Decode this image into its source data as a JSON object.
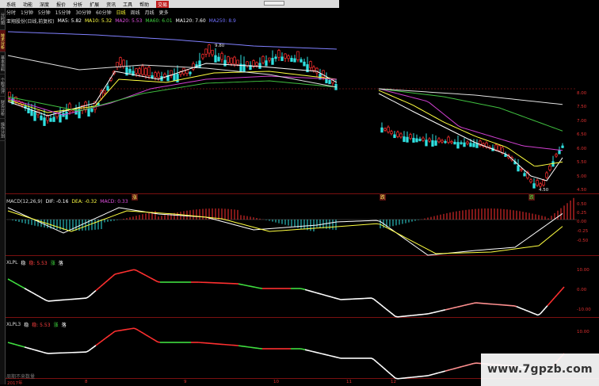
{
  "menu": [
    "系统",
    "功能",
    "深度",
    "报价",
    "分析",
    "扩展",
    "资讯",
    "工具",
    "帮助"
  ],
  "menu_active": "交易",
  "side_tabs": [
    "分时图",
    "技术分析",
    "基本资料",
    "个股点评",
    "财务分析",
    "操作计划"
  ],
  "periods": [
    "分时",
    "1分钟",
    "5分钟",
    "15分钟",
    "30分钟",
    "60分钟",
    "日线",
    "周线",
    "月线",
    "更多"
  ],
  "active_period": "日线",
  "main_legend": {
    "title": "亚翔股份(日线,前复权)",
    "ma5": "MA5: 5.82",
    "ma10": "MA10: 5.32",
    "ma20": "MA20: 5.53",
    "ma60": "MA60: 6.01",
    "ma120": "MA120: 7.60",
    "ma250": "MA250: 8.9"
  },
  "price_axis": [
    "8.00",
    "7.50",
    "7.00",
    "6.50",
    "6.00",
    "5.50",
    "5.00",
    "4.50"
  ],
  "macd_legend": {
    "title": "MACD(12,26,9)",
    "dif": "DIF: -0.16",
    "dea": "DEA: -0.32",
    "macd": "MACD: 0.33"
  },
  "macd_axis": [
    "0.50",
    "0.25",
    "0.00",
    "-0.25",
    "-0.50"
  ],
  "xlpl_legend": {
    "title": "XLPL",
    "col": "稳",
    "val": "稳: 5.53",
    "up": "涨",
    "down": "落"
  },
  "xlpl_axis": [
    "10.00",
    "0.00",
    "-10.00"
  ],
  "xlpl3_legend": {
    "title": "XLPL3",
    "col": "稳",
    "val": "稳: 5.53",
    "up": "涨",
    "down": "落"
  },
  "xlpl3_axis": [
    "10.00"
  ],
  "annotations": {
    "high": "9.80",
    "low": "4.50",
    "flag_a": "涨",
    "flag_b": "跌",
    "flag_c": "跌"
  },
  "time_axis": [
    "2017年",
    "8",
    "9",
    "10",
    "11",
    "12"
  ],
  "footnote": "周期不来数量",
  "watermark": "www.7gpzb.com",
  "colors": {
    "up": "#ff3030",
    "down": "#30e0e0",
    "ma5": "#ffffff",
    "ma10": "#ffff40",
    "ma20": "#d040d0",
    "ma60": "#40c040",
    "ma120": "#8080ff"
  }
}
